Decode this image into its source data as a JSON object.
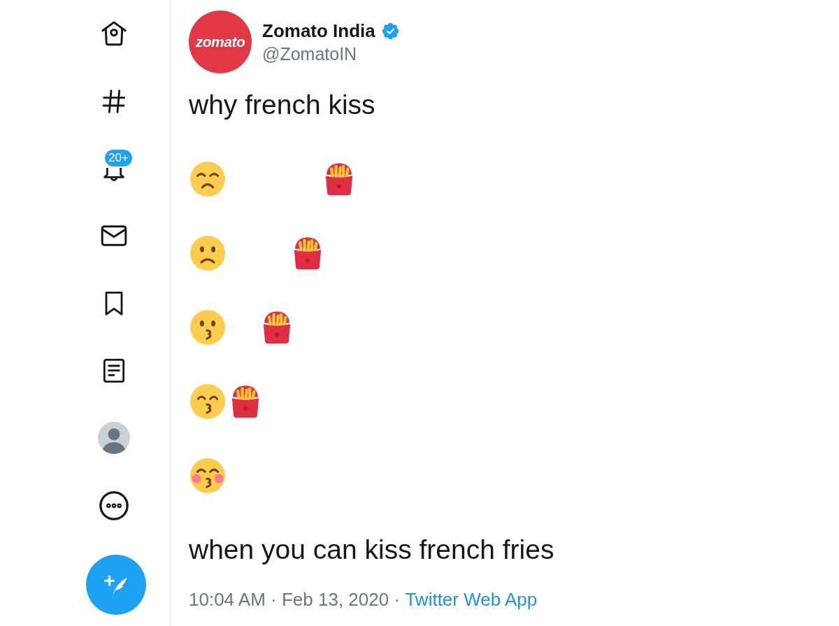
{
  "sidebar": {
    "items": [
      {
        "kind": "home",
        "selected": false
      },
      {
        "kind": "explore",
        "selected": false
      },
      {
        "kind": "notifications",
        "selected": false,
        "badge": "20+"
      },
      {
        "kind": "messages",
        "selected": false
      },
      {
        "kind": "bookmarks",
        "selected": false
      },
      {
        "kind": "lists",
        "selected": false
      },
      {
        "kind": "profile",
        "selected": false
      },
      {
        "kind": "more",
        "selected": false
      }
    ],
    "compose_button": true
  },
  "tweet": {
    "author": {
      "logo_text": "zomato",
      "name": "Zomato India",
      "verified": true,
      "handle": "@ZomatoIN"
    },
    "body": [
      {
        "kind": "text",
        "text": "why french kiss"
      },
      {
        "kind": "emojis",
        "emojis": [
          {
            "kind": "disappointed"
          },
          {
            "kind": "space"
          },
          {
            "kind": "space"
          },
          {
            "kind": "space"
          },
          {
            "kind": "fries"
          }
        ]
      },
      {
        "kind": "emojis",
        "emojis": [
          {
            "kind": "frowning"
          },
          {
            "kind": "space"
          },
          {
            "kind": "space"
          },
          {
            "kind": "fries"
          }
        ]
      },
      {
        "kind": "emojis",
        "emojis": [
          {
            "kind": "pucker"
          },
          {
            "kind": "space"
          },
          {
            "kind": "fries"
          }
        ]
      },
      {
        "kind": "emojis",
        "emojis": [
          {
            "kind": "kiss"
          },
          {
            "kind": "fries"
          }
        ]
      },
      {
        "kind": "emojis",
        "emojis": [
          {
            "kind": "blush"
          }
        ]
      },
      {
        "kind": "text",
        "text": "when you can kiss french fries"
      }
    ],
    "meta": {
      "timestamp": "10:04 AM · Feb 13, 2020",
      "separator": "·",
      "source": "Twitter Web App"
    }
  }
}
